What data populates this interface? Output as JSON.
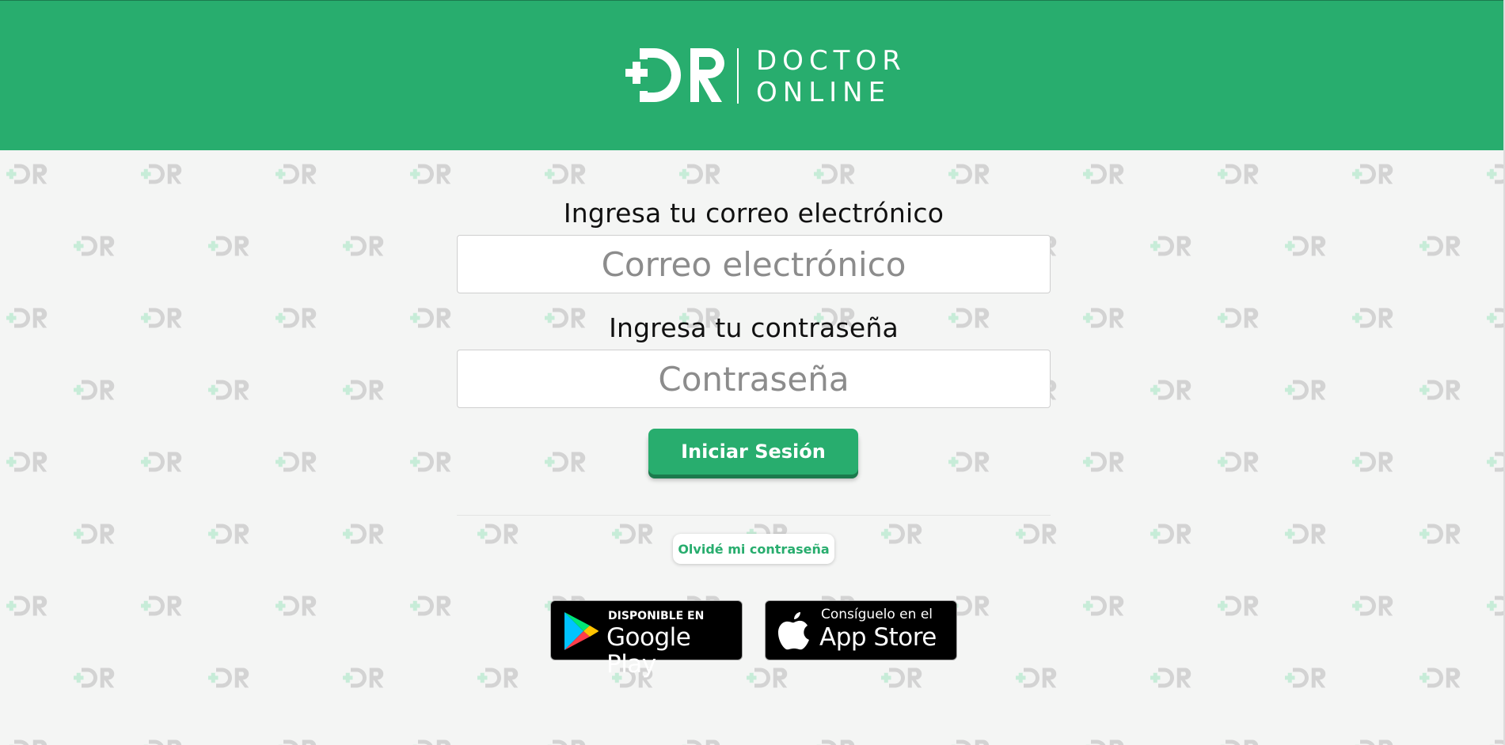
{
  "header": {
    "logo_text_line1": "DOCTOR",
    "logo_text_line2": "ONLINE",
    "background_color": "#28ad6e"
  },
  "form": {
    "email_label": "Ingresa tu correo electrónico",
    "email_placeholder": "Correo electrónico",
    "password_label": "Ingresa tu contraseña",
    "password_placeholder": "Contraseña",
    "login_button": "Iniciar Sesión",
    "forgot_password_button": "Olvidé mi contraseña"
  },
  "stores": {
    "google": {
      "small_text": "DISPONIBLE EN",
      "big_text": "Google Play"
    },
    "apple": {
      "small_text": "Consíguelo en el",
      "big_text": "App Store"
    }
  },
  "colors": {
    "accent": "#28ad6e",
    "accent_dark": "#1c7a4d",
    "background": "#f4f5f4"
  }
}
